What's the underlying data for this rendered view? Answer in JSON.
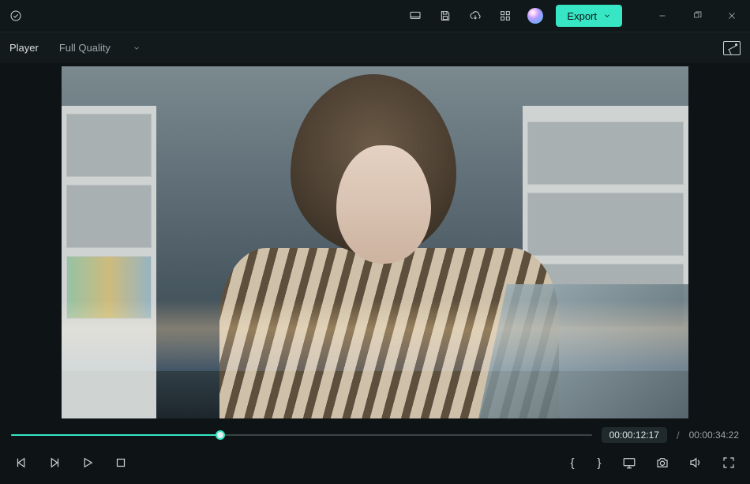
{
  "titlebar": {
    "export_label": "Export"
  },
  "subbar": {
    "player_label": "Player",
    "quality_label": "Full Quality"
  },
  "playback": {
    "progress_percent": 36,
    "current_time": "00:00:12:17",
    "separator": "/",
    "total_time": "00:00:34:22"
  },
  "markers": {
    "in_label": "{",
    "out_label": "}"
  }
}
